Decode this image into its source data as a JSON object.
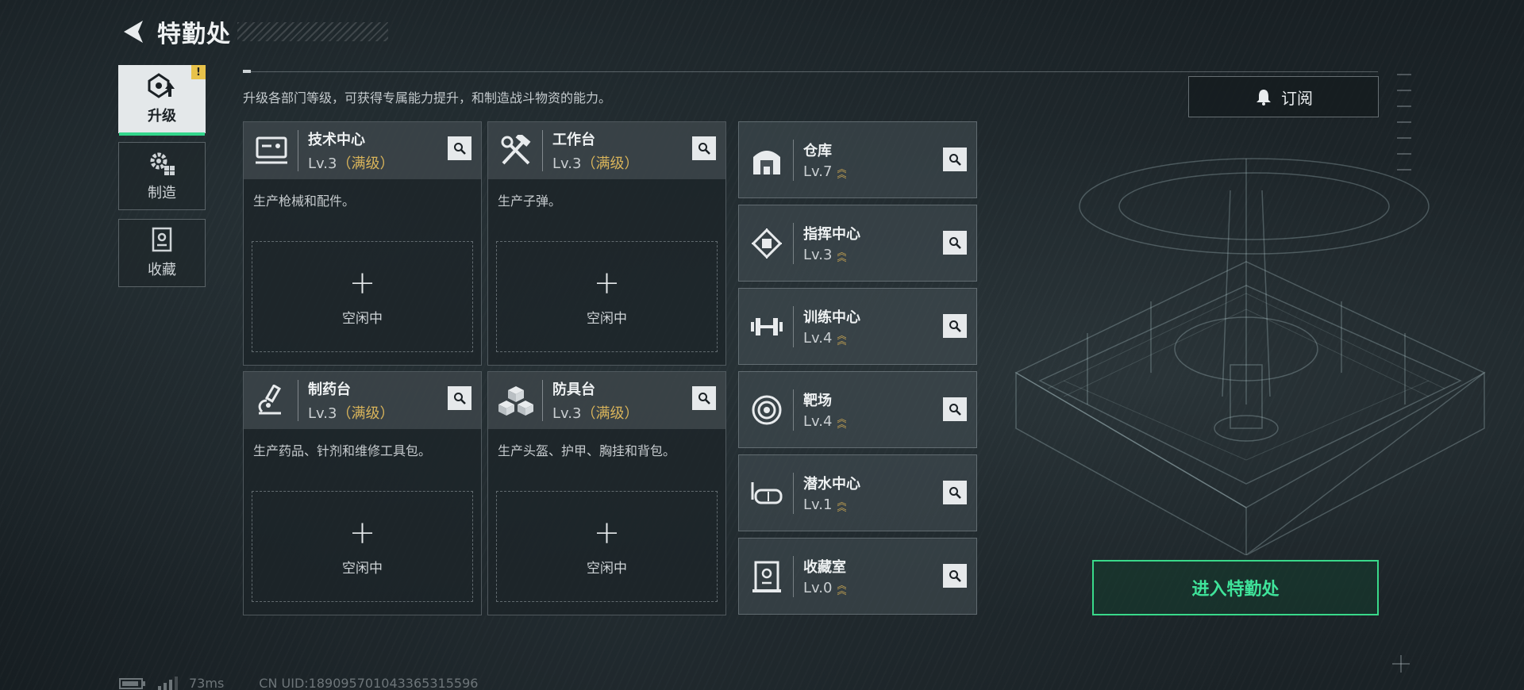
{
  "header": {
    "title": "特勤处"
  },
  "sidenav": [
    {
      "label": "升级",
      "icon": "upgrade-icon",
      "badge": "!"
    },
    {
      "label": "制造",
      "icon": "gear-icon"
    },
    {
      "label": "收藏",
      "icon": "collection-icon"
    }
  ],
  "description": "升级各部门等级，可获得专属能力提升，和制造战斗物资的能力。",
  "subscribe_label": "订阅",
  "workshops": [
    {
      "name": "技术中心",
      "level": "Lv.3",
      "max_label": "（满级）",
      "desc": "生产枪械和配件。",
      "slot_label": "空闲中",
      "icon": "tech-terminal-icon"
    },
    {
      "name": "工作台",
      "level": "Lv.3",
      "max_label": "（满级）",
      "desc": "生产子弹。",
      "slot_label": "空闲中",
      "icon": "tools-icon"
    },
    {
      "name": "制药台",
      "level": "Lv.3",
      "max_label": "（满级）",
      "desc": "生产药品、针剂和维修工具包。",
      "slot_label": "空闲中",
      "icon": "microscope-icon"
    },
    {
      "name": "防具台",
      "level": "Lv.3",
      "max_label": "（满级）",
      "desc": "生产头盔、护甲、胸挂和背包。",
      "slot_label": "空闲中",
      "icon": "armor-icon"
    }
  ],
  "facilities": [
    {
      "name": "仓库",
      "level": "Lv.7",
      "icon": "warehouse-icon"
    },
    {
      "name": "指挥中心",
      "level": "Lv.3",
      "icon": "command-chip-icon"
    },
    {
      "name": "训练中心",
      "level": "Lv.4",
      "icon": "dumbbell-icon"
    },
    {
      "name": "靶场",
      "level": "Lv.4",
      "icon": "target-icon"
    },
    {
      "name": "潜水中心",
      "level": "Lv.1",
      "icon": "diving-mask-icon"
    },
    {
      "name": "收藏室",
      "level": "Lv.0",
      "icon": "collection-room-icon"
    }
  ],
  "enter_label": "进入特勤处",
  "status": {
    "ping": "73ms",
    "uid": "CN UID:1890957010433653155​96"
  },
  "colors": {
    "accent": "#39d98a",
    "max_level": "#d9b45a",
    "badge": "#e8c24a"
  }
}
